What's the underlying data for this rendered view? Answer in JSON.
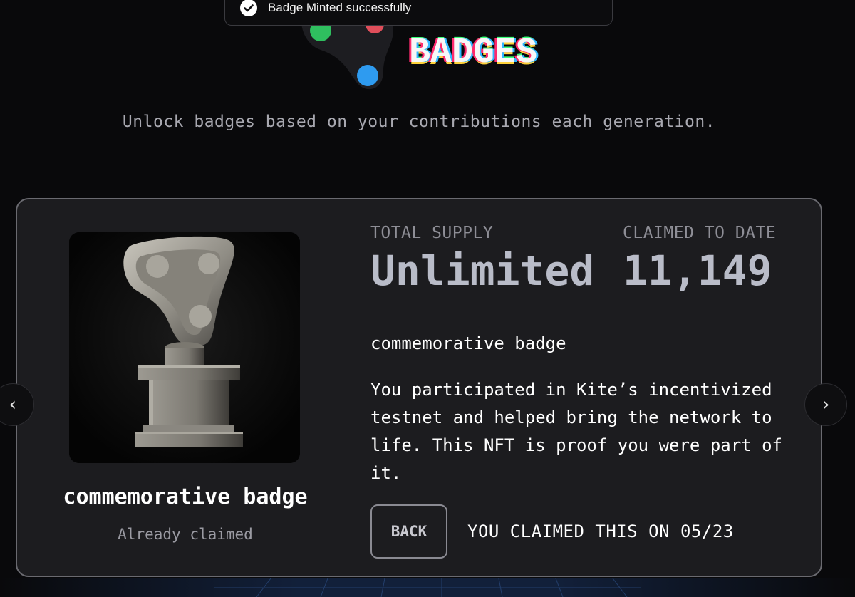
{
  "toast": {
    "message": "Badge Minted successfully",
    "icon": "check-circle-icon"
  },
  "header": {
    "logo_word": "BADGES",
    "subtitle": "Unlock badges based on your contributions each generation."
  },
  "badge": {
    "image": "stone-sculpture-badge",
    "name": "commemorative badge",
    "status": "Already claimed"
  },
  "stats": {
    "total_supply_label": "TOTAL SUPPLY",
    "total_supply_value": "Unlimited",
    "claimed_label": "CLAIMED TO DATE",
    "claimed_value": "11,149"
  },
  "details": {
    "title": "commemorative badge",
    "description": "You participated in Kite’s incentivized testnet and helped bring the network to life. This NFT is proof you were part of it."
  },
  "actions": {
    "back_label": "BACK",
    "claimed_on": "YOU CLAIMED THIS ON 05/23"
  },
  "nav": {
    "prev_symbol": "‹",
    "next_symbol": "›"
  },
  "colors": {
    "background": "#09090b",
    "card": "#1c1c1f",
    "stat_value": "#b9bcc8",
    "logo_dot_green": "#2fbf5f",
    "logo_dot_red": "#e04e5a",
    "logo_dot_blue": "#2e9bf0"
  }
}
